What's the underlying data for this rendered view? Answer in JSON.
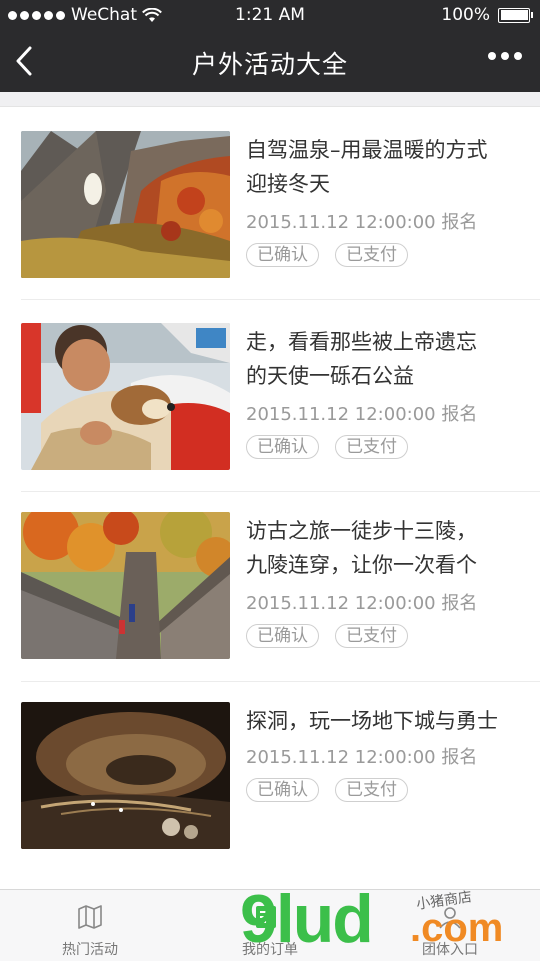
{
  "status_bar": {
    "carrier": "WeChat",
    "time": "1:21 AM",
    "battery": "100%"
  },
  "nav": {
    "title": "户外活动大全"
  },
  "activities": [
    {
      "title_line1": "自驾温泉–用最温暖的方式",
      "title_line2": "迎接冬天",
      "datetime": "2015.11.12 12:00:00",
      "action": "报名",
      "tag1": "已确认",
      "tag2": "已支付"
    },
    {
      "title_line1": "走，看看那些被上帝遗忘",
      "title_line2": "的天使一砾石公益",
      "datetime": "2015.11.12 12:00:00",
      "action": "报名",
      "tag1": "已确认",
      "tag2": "已支付"
    },
    {
      "title_line1": "访古之旅一徒步十三陵，",
      "title_line2": "九陵连穿，让你一次看个",
      "datetime": "2015.11.12 12:00:00",
      "action": "报名",
      "tag1": "已确认",
      "tag2": "已支付"
    },
    {
      "title_line1": "探洞，玩一场地下城与勇士",
      "title_line2": "",
      "datetime": "2015.11.12 12:00:00",
      "action": "报名",
      "tag1": "已确认",
      "tag2": "已支付"
    }
  ],
  "tabs": [
    {
      "label": "热门活动",
      "icon": "map-icon"
    },
    {
      "label": "我的订单",
      "icon": "order-list-icon"
    },
    {
      "label": "团体入口",
      "icon": "group-icon"
    }
  ],
  "watermark": {
    "brand": "9lud",
    "suffix": ".com",
    "small": "小猪商店"
  },
  "colors": {
    "header_bg": "#2b2b2d",
    "watermark_green": "#3cbf4a",
    "watermark_orange": "#f08a24"
  }
}
